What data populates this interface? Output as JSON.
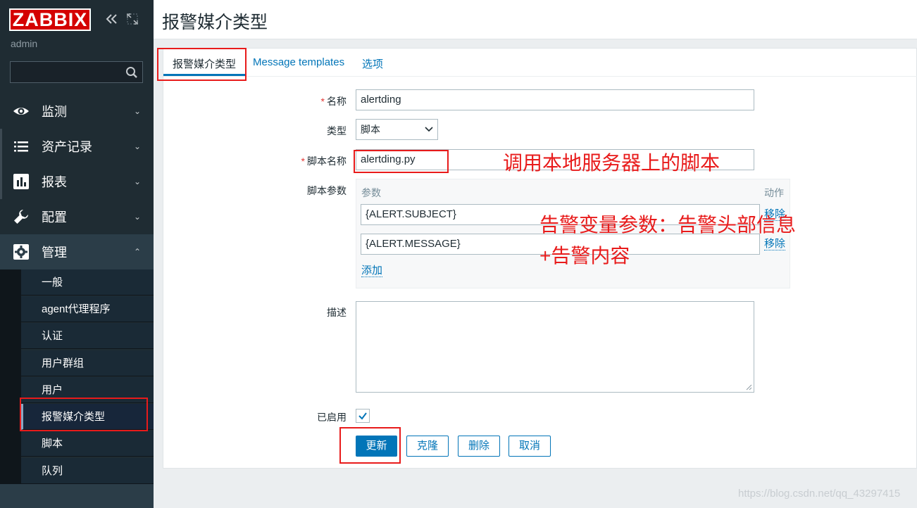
{
  "sidebar": {
    "logo": "ZABBIX",
    "user": "admin",
    "menu": [
      {
        "label": "监测",
        "icon": "eye-icon"
      },
      {
        "label": "资产记录",
        "icon": "list-icon"
      },
      {
        "label": "报表",
        "icon": "bar-chart-icon"
      },
      {
        "label": "配置",
        "icon": "wrench-icon"
      },
      {
        "label": "管理",
        "icon": "gear-icon"
      }
    ],
    "submenu": [
      "一般",
      "agent代理程序",
      "认证",
      "用户群组",
      "用户",
      "报警媒介类型",
      "脚本",
      "队列"
    ]
  },
  "header": {
    "title": "报警媒介类型"
  },
  "tabs": [
    "报警媒介类型",
    "Message templates",
    "选项"
  ],
  "form": {
    "name_label": "名称",
    "name_value": "alertding",
    "type_label": "类型",
    "type_value": "脚本",
    "script_label": "脚本名称",
    "script_value": "alertding.py",
    "params_label": "脚本参数",
    "params_col_param": "参数",
    "params_col_action": "动作",
    "params": [
      {
        "value": "{ALERT.SUBJECT}",
        "action": "移除"
      },
      {
        "value": "{ALERT.MESSAGE}",
        "action": "移除"
      }
    ],
    "add_label": "添加",
    "desc_label": "描述",
    "enabled_label": "已启用",
    "enabled": true
  },
  "buttons": {
    "update": "更新",
    "clone": "克隆",
    "delete": "删除",
    "cancel": "取消"
  },
  "annotations": {
    "script_note": "调用本地服务器上的脚本",
    "params_note_line1": "告警变量参数：告警头部信息",
    "params_note_line2": "+告警内容"
  },
  "watermark": "https://blog.csdn.net/qq_43297415"
}
